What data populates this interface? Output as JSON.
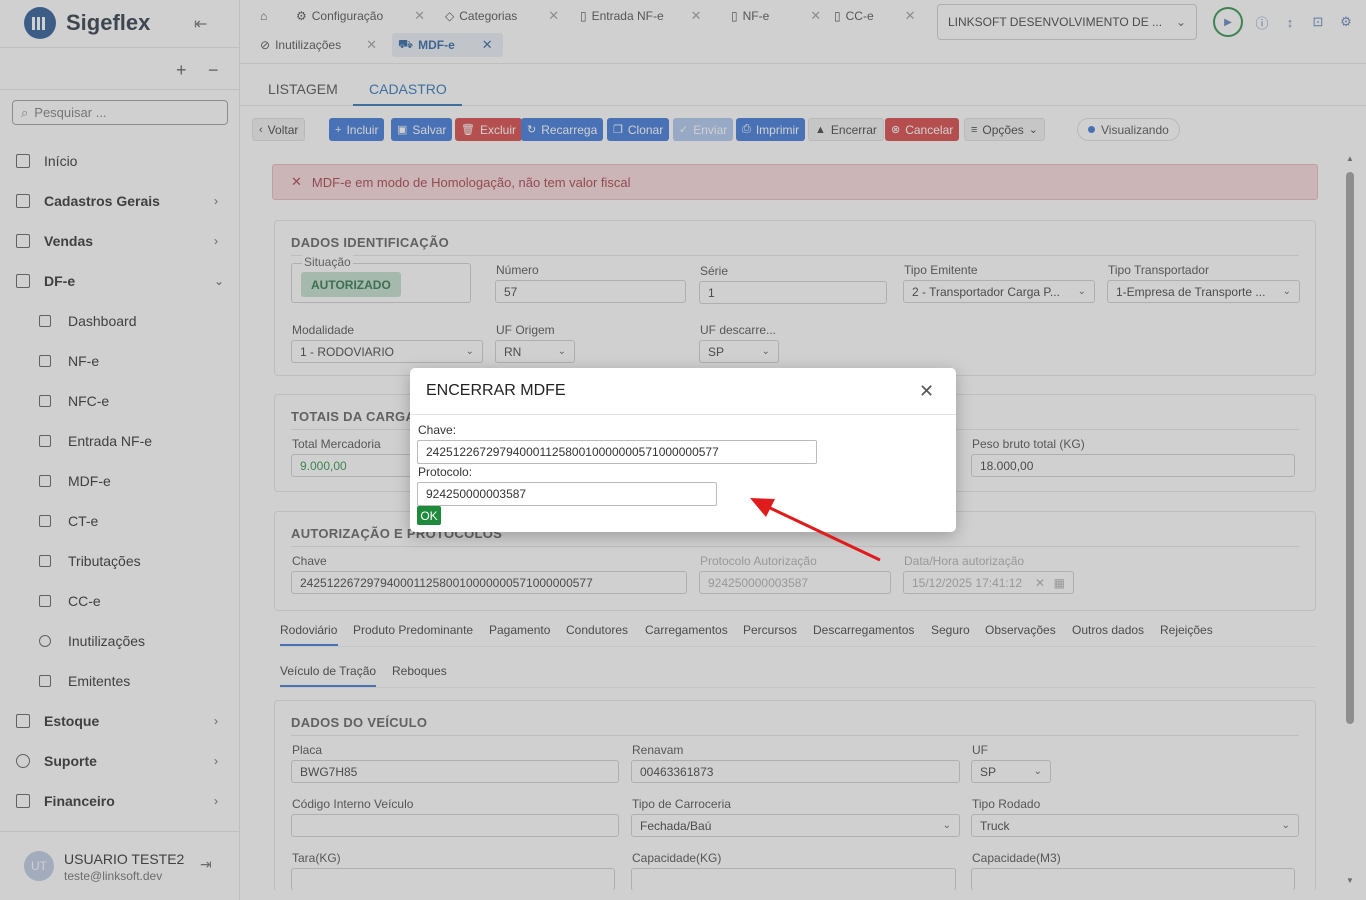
{
  "app": {
    "name": "Sigeflex"
  },
  "sidebar": {
    "search_placeholder": "Pesquisar ...",
    "items": [
      {
        "label": "Início"
      },
      {
        "label": "Cadastros Gerais"
      },
      {
        "label": "Vendas"
      },
      {
        "label": "DF-e"
      },
      {
        "label": "Dashboard"
      },
      {
        "label": "NF-e"
      },
      {
        "label": "NFC-e"
      },
      {
        "label": "Entrada NF-e"
      },
      {
        "label": "MDF-e"
      },
      {
        "label": "CT-e"
      },
      {
        "label": "Tributações"
      },
      {
        "label": "CC-e"
      },
      {
        "label": "Inutilizações"
      },
      {
        "label": "Emitentes"
      },
      {
        "label": "Estoque"
      },
      {
        "label": "Suporte"
      },
      {
        "label": "Financeiro"
      }
    ],
    "user": {
      "initials": "UT",
      "name": "USUARIO TESTE2",
      "email": "teste@linksoft.dev"
    }
  },
  "tabs": [
    {
      "label": "Configuração"
    },
    {
      "label": "Categorias"
    },
    {
      "label": "Entrada NF-e"
    },
    {
      "label": "NF-e"
    },
    {
      "label": "CC-e"
    },
    {
      "label": "Inutilizações"
    },
    {
      "label": "MDF-e"
    }
  ],
  "company": "LINKSOFT DESENVOLVIMENTO DE ...",
  "subtabs": {
    "list": "LISTAGEM",
    "form": "CADASTRO"
  },
  "toolbar": {
    "back": "Voltar",
    "add": "Incluir",
    "save": "Salvar",
    "delete": "Excluir",
    "reload": "Recarrega",
    "clone": "Clonar",
    "send": "Enviar",
    "print": "Imprimir",
    "close": "Encerrar",
    "cancel": "Cancelar",
    "options": "Opções",
    "mode": "Visualizando"
  },
  "alert": "MDF-e em modo de Homologação, não tem valor fiscal",
  "ident": {
    "title": "DADOS IDENTIFICAÇÃO",
    "situacao_label": "Situação",
    "situacao": "AUTORIZADO",
    "numero_label": "Número",
    "numero": "57",
    "serie_label": "Série",
    "serie": "1",
    "tipo_emitente_label": "Tipo Emitente",
    "tipo_emitente": "2 - Transportador Carga P...",
    "tipo_transp_label": "Tipo Transportador",
    "tipo_transp": "1-Empresa de Transporte ...",
    "modalidade_label": "Modalidade",
    "modalidade": "1 - RODOVIARIO",
    "uf_origem_label": "UF Origem",
    "uf_origem": "RN",
    "uf_desc_label": "UF descarre...",
    "uf_desc": "SP"
  },
  "totais": {
    "title": "TOTAIS DA CARGA",
    "total_merc_label": "Total Mercadoria",
    "total_merc": "9.000,00",
    "peso_label": "Peso bruto total (KG)",
    "peso": "18.000,00"
  },
  "autorizacao": {
    "title": "AUTORIZAÇÃO E PROTOCOLOS",
    "chave_label": "Chave",
    "chave": "24251226729794000112580010000000571000000577",
    "protocolo_label": "Protocolo Autorização",
    "protocolo": "924250000003587",
    "data_label": "Data/Hora autorização",
    "data": "15/12/2025 17:41:12"
  },
  "section_tabs": [
    "Rodoviário",
    "Produto Predominante",
    "Pagamento",
    "Condutores",
    "Carregamentos",
    "Percursos",
    "Descarregamentos",
    "Seguro",
    "Observações",
    "Outros dados",
    "Rejeições"
  ],
  "vehicle_tabs": [
    "Veículo de Tração",
    "Reboques"
  ],
  "veiculo": {
    "title": "DADOS DO VEÍCULO",
    "placa_label": "Placa",
    "placa": "BWG7H85",
    "renavam_label": "Renavam",
    "renavam": "00463361873",
    "uf_label": "UF",
    "uf": "SP",
    "cod_label": "Código Interno Veículo",
    "cod": "",
    "carroceria_label": "Tipo de Carroceria",
    "carroceria": "Fechada/Baú",
    "rodado_label": "Tipo Rodado",
    "rodado": "Truck",
    "tara_label": "Tara(KG)",
    "cap_kg_label": "Capacidade(KG)",
    "cap_m3_label": "Capacidade(M3)"
  },
  "modal": {
    "title": "ENCERRAR MDFE",
    "chave_label": "Chave:",
    "chave": "24251226729794000112580010000000571000000577",
    "protocolo_label": "Protocolo:",
    "protocolo": "924250000003587",
    "ok": "OK"
  },
  "colors": {
    "primary": "#2f6fd6",
    "danger": "#d63a3a",
    "success": "#208a3c",
    "annotation_arrow": "#e01b1b"
  }
}
